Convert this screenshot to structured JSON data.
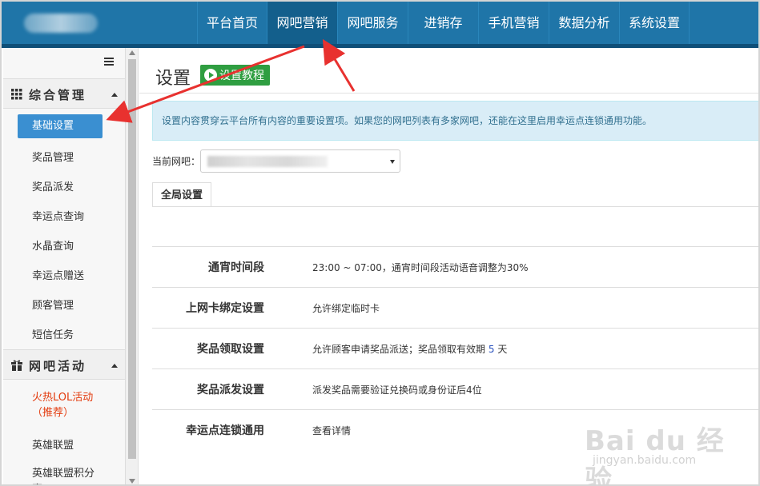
{
  "nav": {
    "items": [
      "平台首页",
      "网吧营销",
      "网吧服务",
      "进销存",
      "手机营销",
      "数据分析",
      "系统设置"
    ],
    "active_index": 1
  },
  "sidebar": {
    "sections": [
      {
        "title": "综合管理",
        "icon": "grid-icon",
        "items": [
          "基础设置",
          "奖品管理",
          "奖品派发",
          "幸运点查询",
          "水晶查询",
          "幸运点赠送",
          "顾客管理",
          "短信任务"
        ]
      },
      {
        "title": "网吧活动",
        "icon": "gift-icon",
        "items": [
          "火热LOL活动（推荐）",
          "英雄联盟",
          "英雄联盟积分赛"
        ]
      }
    ],
    "active_item": "基础设置"
  },
  "main": {
    "title": "设置",
    "tutorial_button": "设置教程",
    "info": "设置内容贯穿云平台所有内容的重要设置项。如果您的网吧列表有多家网吧，还能在这里启用幸运点连锁通用功能。",
    "current_bar_label": "当前网吧：",
    "tab": "全局设置",
    "rows": [
      {
        "label": "通宵时间段",
        "value": "23:00 ~ 07:00，通宵时间段活动语音调整为30%"
      },
      {
        "label": "上网卡绑定设置",
        "value": "允许绑定临时卡"
      },
      {
        "label": "奖品领取设置",
        "value_prefix": "允许顾客申请奖品派送；奖品领取有效期",
        "value_number": "5",
        "value_suffix": "天"
      },
      {
        "label": "奖品派发设置",
        "value": "派发奖品需要验证兑换码或身份证后4位"
      },
      {
        "label": "幸运点连锁通用",
        "value": "查看详情"
      }
    ]
  },
  "watermark": {
    "brand": "Bai du 经验",
    "site": "jingyan.baidu.com"
  },
  "colors": {
    "topbar": "#1f75a8",
    "active_nav": "#135f8c",
    "active_side": "#3a8fd1",
    "tutorial_green": "#2f9e41",
    "info_bg": "#d9edf7",
    "annotation_red": "#e8312f",
    "hot_text": "#e33b0e"
  }
}
